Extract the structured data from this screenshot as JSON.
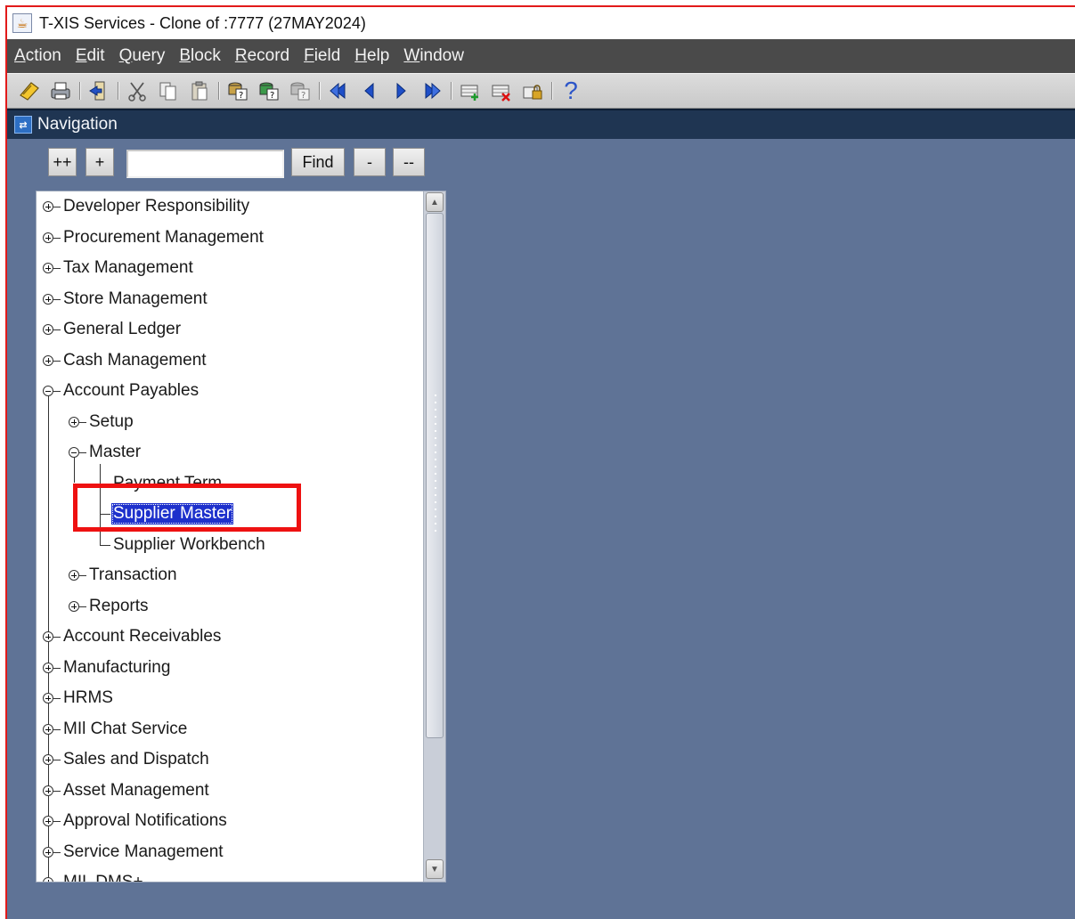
{
  "window": {
    "title": "T-XIS Services - Clone of :7777 (27MAY2024)"
  },
  "menubar": {
    "items": [
      {
        "label": "Action"
      },
      {
        "label": "Edit"
      },
      {
        "label": "Query"
      },
      {
        "label": "Block"
      },
      {
        "label": "Record"
      },
      {
        "label": "Field"
      },
      {
        "label": "Help"
      },
      {
        "label": "Window"
      }
    ]
  },
  "toolbar": {
    "icons": [
      "save-icon",
      "print-icon",
      "exit-icon",
      "cut-icon",
      "copy-icon",
      "paste-icon",
      "enter-query-icon",
      "execute-query-icon",
      "cancel-query-icon",
      "first-record-icon",
      "previous-record-icon",
      "next-record-icon",
      "last-record-icon",
      "insert-record-icon",
      "delete-record-icon",
      "lock-record-icon",
      "help-icon"
    ],
    "help_glyph": "?"
  },
  "navigator": {
    "title": "Navigation",
    "buttons": {
      "expand_all": "++",
      "expand": "+",
      "find": "Find",
      "collapse": "-",
      "collapse_all": "--"
    },
    "find_value": "",
    "tree": {
      "developer_responsibility": "Developer Responsibility",
      "procurement_management": "Procurement Management",
      "tax_management": "Tax Management",
      "store_management": "Store Management",
      "general_ledger": "General Ledger",
      "cash_management": "Cash Management",
      "account_payables": "Account Payables",
      "setup": "Setup",
      "master": "Master",
      "payment_term": "Payment Term",
      "supplier_master": "Supplier Master",
      "supplier_workbench": "Supplier Workbench",
      "transaction": "Transaction",
      "reports": "Reports",
      "account_receivables": "Account Receivables",
      "manufacturing": "Manufacturing",
      "hrms": "HRMS",
      "mil_chat_service": "MIl Chat Service",
      "sales_and_dispatch": "Sales and Dispatch",
      "asset_management": "Asset Management",
      "approval_notifications": "Approval Notifications",
      "service_management": "Service Management",
      "partial_item": "MIL DMS+"
    },
    "selected": "Supplier Master"
  },
  "colors": {
    "annotation_box": "#ee1111",
    "selection": "#1e31cc",
    "workspace": "#5f7396"
  }
}
